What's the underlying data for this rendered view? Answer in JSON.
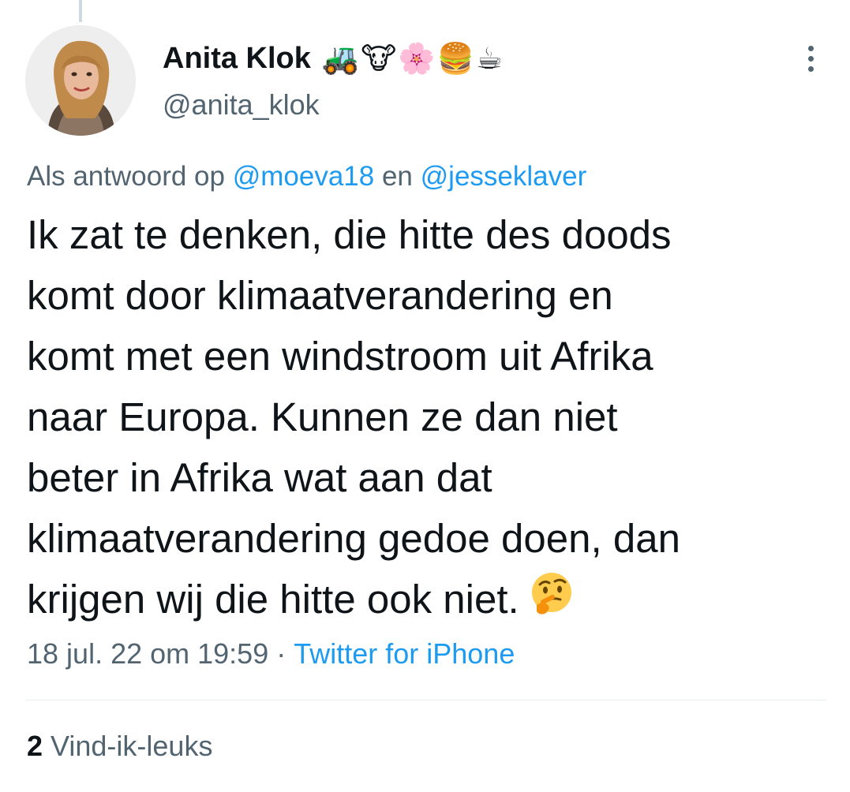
{
  "author": {
    "name": "Anita Klok",
    "name_emojis": "🚜🐮🌸🍔☕",
    "handle": "@anita_klok"
  },
  "reply_context": {
    "prefix": "Als antwoord op",
    "mention_1": "@moeva18",
    "conjunction": "en",
    "mention_2": "@jesseklaver"
  },
  "tweet": {
    "lines": [
      "Ik zat te denken, die hitte des doods",
      "komt door klimaatverandering en",
      "komt met een windstroom uit Afrika",
      "naar Europa. Kunnen ze dan niet",
      "beter in Afrika wat aan dat",
      "klimaatverandering gedoe doen, dan",
      "krijgen wij die hitte ook niet."
    ],
    "trailing_emoji": "thinking-face-emoji"
  },
  "meta": {
    "timestamp": "18 jul. 22 om 19:59",
    "separator": "·",
    "source": "Twitter for iPhone"
  },
  "stats": {
    "likes_count": "2",
    "likes_label": "Vind-ik-leuks"
  },
  "icons": {
    "more": "more-vertical-icon",
    "thinking": "thinking-face-emoji"
  },
  "colors": {
    "link": "#1d9bf0",
    "secondary_text": "#536471",
    "primary_text": "#0f1419",
    "divider": "#e6ecf0"
  }
}
